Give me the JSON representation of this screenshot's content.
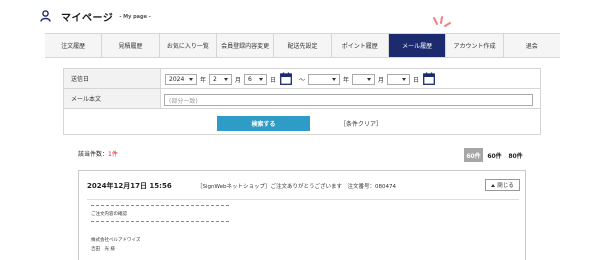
{
  "header": {
    "title": "マイページ",
    "subtitle": "- My page -",
    "icon": "user-icon"
  },
  "nav": {
    "items": [
      {
        "label": "注文履歴",
        "active": false
      },
      {
        "label": "見積履歴",
        "active": false
      },
      {
        "label": "お気に入り一覧",
        "active": false
      },
      {
        "label": "会員登録内容変更",
        "active": false
      },
      {
        "label": "配送先設定",
        "active": false
      },
      {
        "label": "ポイント履歴",
        "active": false
      },
      {
        "label": "メール履歴",
        "active": true
      },
      {
        "label": "アカウント作成",
        "active": false
      },
      {
        "label": "退会",
        "active": false
      }
    ]
  },
  "search": {
    "date_label": "送信日",
    "from_year": "2024",
    "year_unit": "年",
    "from_month": "2",
    "month_unit": "月",
    "from_day": "6",
    "day_unit": "日",
    "range_sep": "〜",
    "to_year": "",
    "to_month": "",
    "to_day": "",
    "body_label": "メール本文",
    "body_placeholder": "(部分一致)",
    "search_button": "検索する",
    "clear_link": "［条件クリア］"
  },
  "results": {
    "count_label": "該当件数：",
    "count_value": "1件",
    "per_page": [
      {
        "label": "60件",
        "active": true
      },
      {
        "label": "60件",
        "active": false
      },
      {
        "label": "80件",
        "active": false
      }
    ]
  },
  "mail": {
    "date": "2024年12月17日 15:56",
    "subject": "［SignWebネットショップ］ご注文ありがとうございます　注文番号：080474",
    "close_button": "閉じる",
    "body_line1": "ご注文内容の確認",
    "body_line2": "株式会社ベルアドワイズ",
    "body_line3": "吉田　光 様"
  },
  "colors": {
    "active_nav": "#1c2a6e",
    "search_button": "#2e9cc7",
    "accent": "#f08080",
    "count_highlight": "#dd2222"
  }
}
